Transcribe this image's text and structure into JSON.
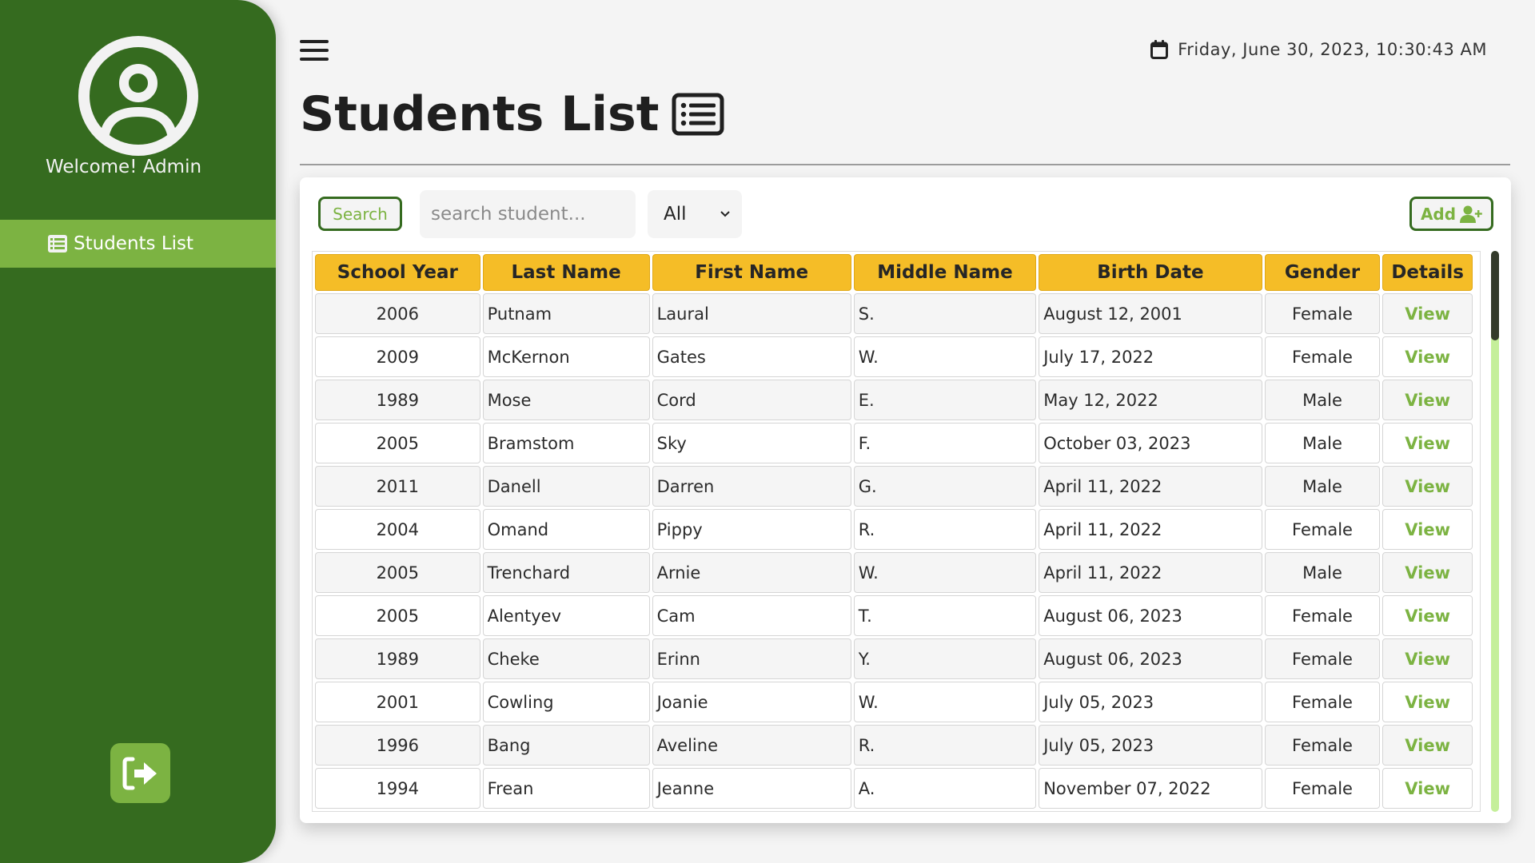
{
  "sidebar": {
    "welcome": "Welcome! Admin",
    "nav": [
      {
        "label": "Students List",
        "icon": "list-alt-icon",
        "active": true
      }
    ],
    "logout_icon": "sign-out-icon"
  },
  "header": {
    "datetime": "Friday, June 30, 2023, 10:30:43 AM",
    "title": "Students List"
  },
  "toolbar": {
    "search_label": "Search",
    "search_placeholder": "search student...",
    "search_value": "",
    "filter_selected": "All",
    "add_label": "Add"
  },
  "colors": {
    "sidebar": "#356b1f",
    "accent": "#7cb342",
    "header": "#f5bd27"
  },
  "table": {
    "columns": [
      "School Year",
      "Last Name",
      "First Name",
      "Middle Name",
      "Birth Date",
      "Gender",
      "Details"
    ],
    "rows": [
      [
        "2006",
        "Putnam",
        "Laural",
        "S.",
        "August 12, 2001",
        "Female",
        "View"
      ],
      [
        "2009",
        "McKernon",
        "Gates",
        "W.",
        "July 17, 2022",
        "Female",
        "View"
      ],
      [
        "1989",
        "Mose",
        "Cord",
        "E.",
        "May 12, 2022",
        "Male",
        "View"
      ],
      [
        "2005",
        "Bramstom",
        "Sky",
        "F.",
        "October 03, 2023",
        "Male",
        "View"
      ],
      [
        "2011",
        "Danell",
        "Darren",
        "G.",
        "April 11, 2022",
        "Male",
        "View"
      ],
      [
        "2004",
        "Omand",
        "Pippy",
        "R.",
        "April 11, 2022",
        "Female",
        "View"
      ],
      [
        "2005",
        "Trenchard",
        "Arnie",
        "W.",
        "April 11, 2022",
        "Male",
        "View"
      ],
      [
        "2005",
        "Alentyev",
        "Cam",
        "T.",
        "August 06, 2023",
        "Female",
        "View"
      ],
      [
        "1989",
        "Cheke",
        "Erinn",
        "Y.",
        "August 06, 2023",
        "Female",
        "View"
      ],
      [
        "2001",
        "Cowling",
        "Joanie",
        "W.",
        "July 05, 2023",
        "Female",
        "View"
      ],
      [
        "1996",
        "Bang",
        "Aveline",
        "R.",
        "July 05, 2023",
        "Female",
        "View"
      ],
      [
        "1994",
        "Frean",
        "Jeanne",
        "A.",
        "November 07, 2022",
        "Female",
        "View"
      ]
    ]
  }
}
